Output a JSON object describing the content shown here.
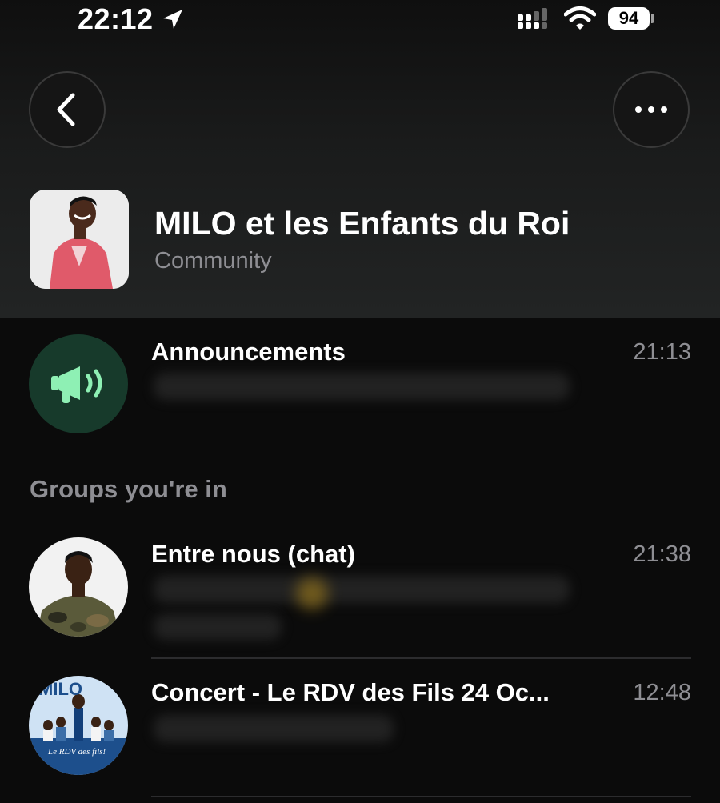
{
  "status_bar": {
    "time": "22:12",
    "battery": "94"
  },
  "header": {
    "back_icon": "chevron-left-icon",
    "more_icon": "ellipsis-icon",
    "community_name": "MILO et les Enfants du Roi",
    "community_label": "Community"
  },
  "announcements": {
    "title": "Announcements",
    "time": "21:13",
    "icon": "megaphone-icon",
    "accent": "#4cd964"
  },
  "groups_section_label": "Groups you're in",
  "groups": [
    {
      "title": "Entre nous (chat)",
      "time": "21:38"
    },
    {
      "title": "Concert - Le RDV des Fils 24 Oc...",
      "time": "12:48",
      "avatar_text_top": "MILO",
      "avatar_text_bottom": "Le RDV des fils!"
    }
  ]
}
